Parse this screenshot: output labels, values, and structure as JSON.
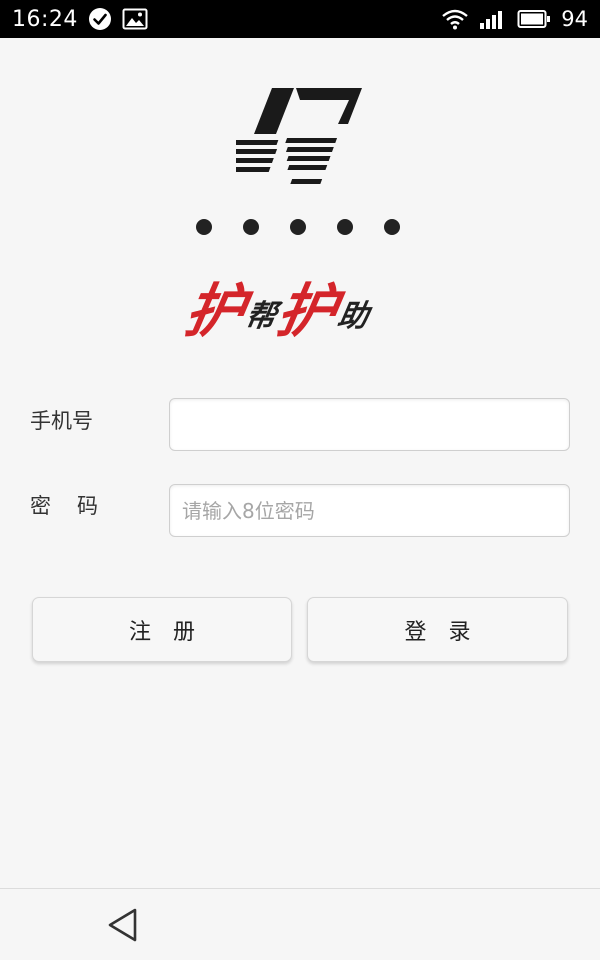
{
  "status_bar": {
    "time": "16:24",
    "battery_level": "94",
    "icons": [
      "check-circle-icon",
      "image-icon",
      "wifi-icon",
      "signal-icon",
      "battery-icon"
    ]
  },
  "brand": {
    "name_char_1": "护",
    "name_char_2": "帮",
    "name_char_3": "护",
    "name_char_4": "助",
    "accent_color": "#d4252a"
  },
  "form": {
    "phone_label": "手机号",
    "phone_value": "",
    "password_label": "密码",
    "password_placeholder": "请输入8位密码",
    "password_value": ""
  },
  "buttons": {
    "register": "注册",
    "login": "登录"
  },
  "nav_bar": {
    "icons": [
      "back-icon"
    ]
  }
}
